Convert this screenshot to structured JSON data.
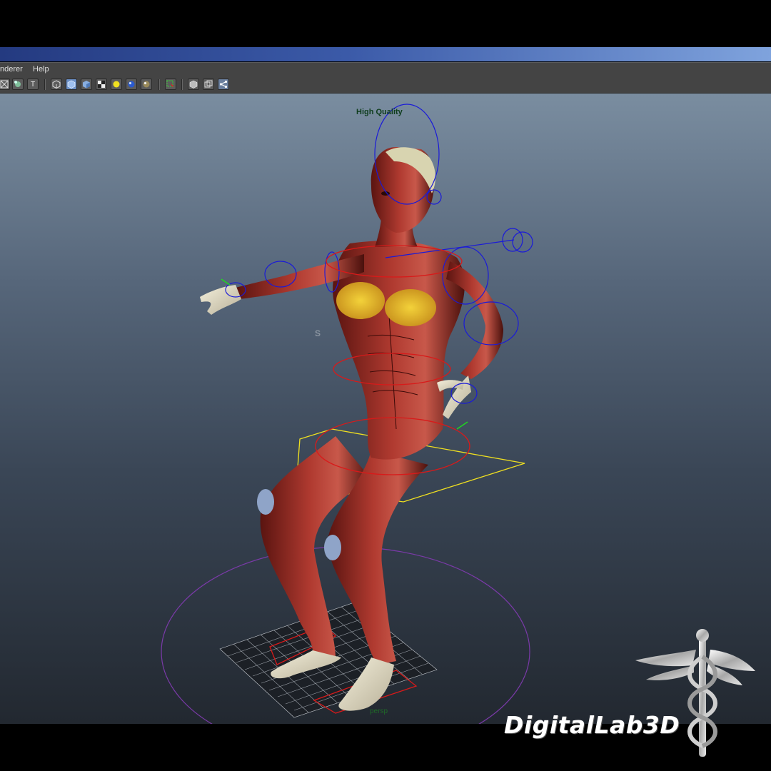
{
  "menu": {
    "items": [
      "nderer",
      "Help"
    ]
  },
  "toolbar": {
    "icons": [
      "wireframe-icon",
      "smooth-shade-icon",
      "texture-icon",
      "cube-wire-icon",
      "cube-shaded-icon",
      "cube-textured-icon",
      "checker-icon",
      "light-yellow-icon",
      "light-blue-icon",
      "material-sphere-icon",
      "select-highlight-icon",
      "cube-icon",
      "isolate-icon",
      "connections-icon"
    ],
    "text_button_label": "T"
  },
  "viewport": {
    "quality_label": "High Quality",
    "camera_label": "persp",
    "pivot_marker": "S"
  },
  "branding": {
    "logo_text": "DigitalLab3D"
  },
  "colors": {
    "title_bar_start": "#243a80",
    "title_bar_end": "#7fa3dd",
    "control_blue": "#1a1ad8",
    "control_red": "#d81a1a",
    "control_yellow": "#f0e020",
    "ground_ring": "#7a3aa8"
  }
}
